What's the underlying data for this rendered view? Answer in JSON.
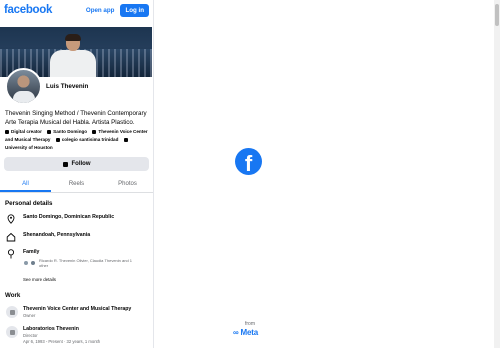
{
  "header": {
    "brand": "facebook",
    "open_app": "Open app",
    "login": "Log in"
  },
  "profile": {
    "name": "Luis Thevenin",
    "bio": "Thevenin Singing Method / Thevenin Contemporary Arte Terapia Musical del Habla. Artista Plastico.",
    "facts": [
      "Digital creator",
      "Santo Domingo",
      "Thevenin Voice Center and Musical Therapy",
      "colegio santisima trinidad",
      "University of Houston"
    ],
    "follow": "Follow"
  },
  "tabs": [
    "All",
    "Reels",
    "Photos"
  ],
  "personal": {
    "title": "Personal details",
    "current_city": "Santo Domingo, Dominican Republic",
    "hometown": "Shenandoah, Pennsylvania",
    "family_label": "Family",
    "family_members": "Ricardo R. Thevenin Olivier, Claudia Thevenin and 1 other",
    "see_more": "See more details"
  },
  "work": {
    "title": "Work",
    "items": [
      {
        "name": "Thevenin Voice Center and Musical Therapy",
        "role": "Owner",
        "dates": ""
      },
      {
        "name": "Laboratorios Thevenin",
        "role": "Director",
        "dates": "Apr 6, 1993 - Present · 32 years, 1 month"
      }
    ]
  },
  "right_panel": {
    "logo_glyph": "f",
    "from": "from",
    "meta": "Meta"
  },
  "colors": {
    "brand_blue": "#1877f2",
    "button_grey": "#e4e6eb",
    "secondary_text": "#65676b"
  }
}
